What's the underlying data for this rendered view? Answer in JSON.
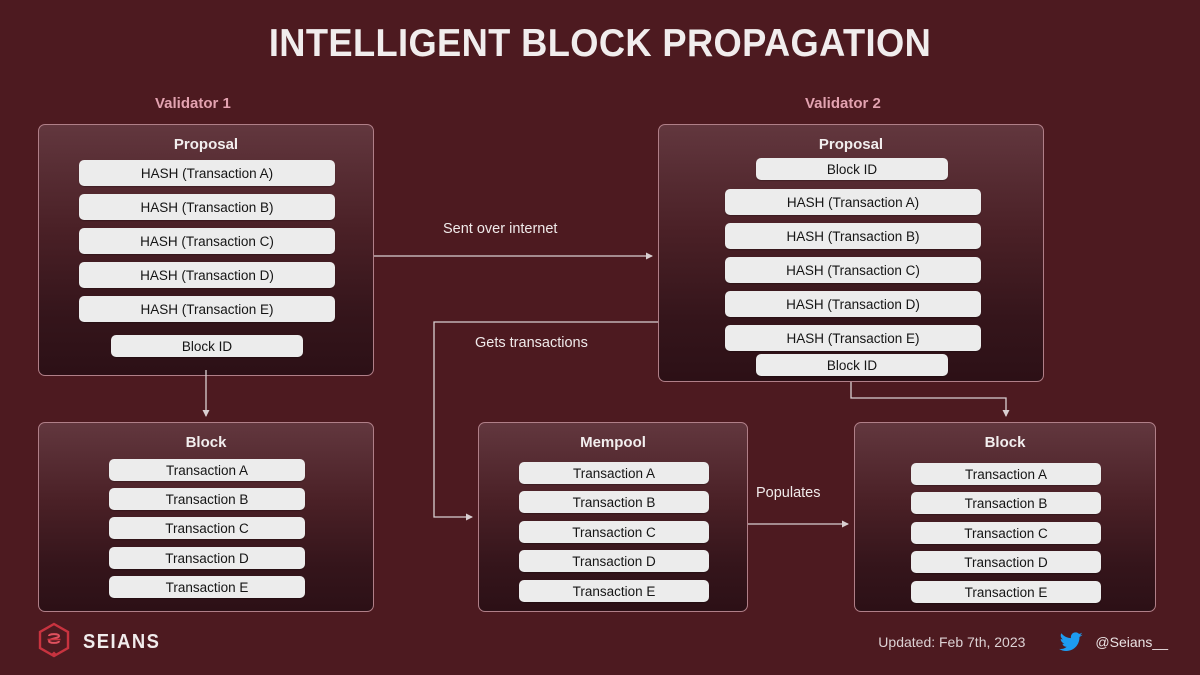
{
  "page": {
    "title": "INTELLIGENT BLOCK PROPAGATION",
    "background_color": "#4d1a20",
    "accent_pink": "#e3a2b0",
    "row_color": "#ececec",
    "twitter_blue": "#1d9bf0",
    "logo_red": "#c8333f"
  },
  "validators": {
    "left_label": "Validator 1",
    "right_label": "Validator 2"
  },
  "panels": {
    "proposal_1": {
      "title": "Proposal",
      "rows": [
        "HASH (Transaction A)",
        "HASH (Transaction B)",
        "HASH (Transaction C)",
        "HASH (Transaction D)",
        "HASH (Transaction E)",
        "Block ID"
      ]
    },
    "proposal_2": {
      "title": "Proposal",
      "rows": [
        "Block ID",
        "HASH (Transaction A)",
        "HASH (Transaction B)",
        "HASH (Transaction C)",
        "HASH (Transaction D)",
        "HASH (Transaction E)",
        "Block ID"
      ]
    },
    "block_1": {
      "title": "Block",
      "rows": [
        "Transaction A",
        "Transaction B",
        "Transaction C",
        "Transaction D",
        "Transaction E"
      ]
    },
    "mempool": {
      "title": "Mempool",
      "rows": [
        "Transaction A",
        "Transaction B",
        "Transaction C",
        "Transaction D",
        "Transaction E"
      ]
    },
    "block_2": {
      "title": "Block",
      "rows": [
        "Transaction A",
        "Transaction B",
        "Transaction C",
        "Transaction D",
        "Transaction E"
      ]
    }
  },
  "edges": {
    "sent_over_internet": "Sent over internet",
    "gets_transactions": "Gets transactions",
    "populates": "Populates"
  },
  "footer": {
    "brand": "SEIANS",
    "updated": "Updated: Feb 7th, 2023",
    "handle": "@Seians__"
  }
}
